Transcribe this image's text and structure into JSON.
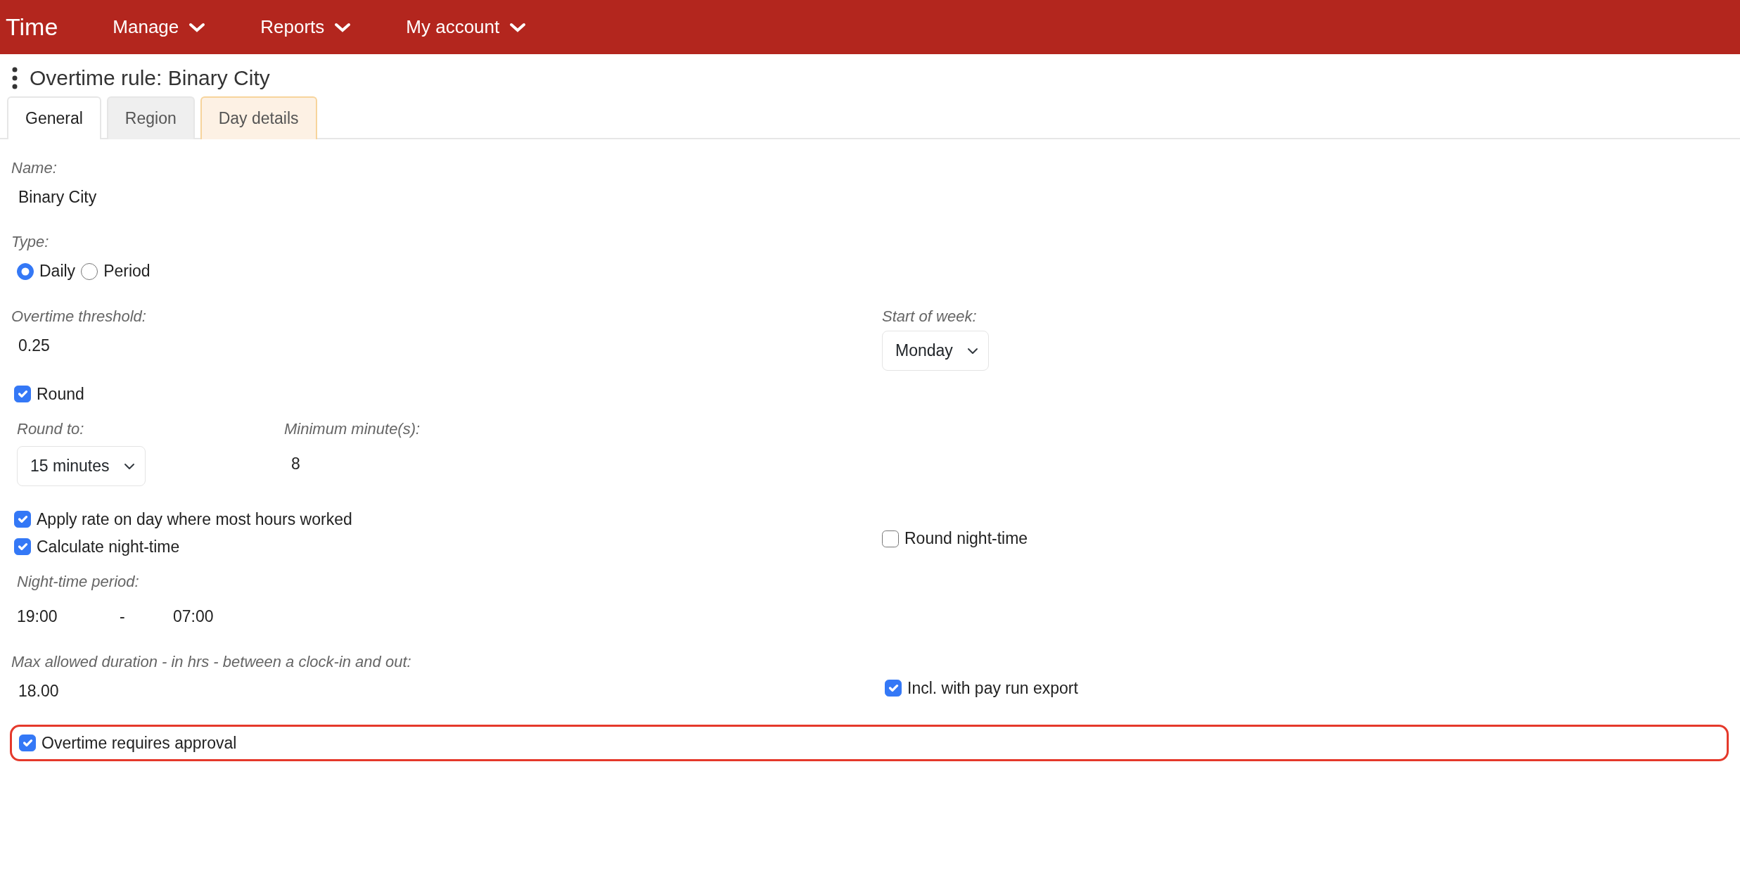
{
  "navbar": {
    "brand": "Time",
    "menus": [
      {
        "label": "Manage"
      },
      {
        "label": "Reports"
      },
      {
        "label": "My account"
      }
    ]
  },
  "page_title": "Overtime rule: Binary City",
  "tabs": [
    {
      "label": "General",
      "selected": true,
      "kind": "plain"
    },
    {
      "label": "Region",
      "selected": false,
      "kind": "plain"
    },
    {
      "label": "Day details",
      "selected": false,
      "kind": "warning"
    }
  ],
  "name": {
    "label": "Name:",
    "value": "Binary City"
  },
  "type": {
    "label": "Type:",
    "options": [
      {
        "label": "Daily",
        "selected": true
      },
      {
        "label": "Period",
        "selected": false
      }
    ]
  },
  "overtime_threshold": {
    "label": "Overtime threshold:",
    "value": "0.25"
  },
  "start_of_week": {
    "label": "Start of week:",
    "value": "Monday"
  },
  "round": {
    "label": "Round",
    "checked": true
  },
  "round_to": {
    "label": "Round to:",
    "value": "15 minutes"
  },
  "minimum_minutes": {
    "label": "Minimum minute(s):",
    "value": "8"
  },
  "apply_rate": {
    "label": "Apply rate on day where most hours worked",
    "checked": true
  },
  "calculate_night_time": {
    "label": "Calculate night-time",
    "checked": true
  },
  "round_night_time": {
    "label": "Round night-time",
    "checked": false
  },
  "night_time_period": {
    "label": "Night-time period:",
    "start": "19:00",
    "separator": "-",
    "end": "07:00"
  },
  "max_duration": {
    "label": "Max allowed duration - in hrs - between a clock-in and out:",
    "value": "18.00"
  },
  "incl_pay_run_export": {
    "label": "Incl. with pay run export",
    "checked": true
  },
  "overtime_requires_approval": {
    "label": "Overtime requires approval",
    "checked": true,
    "highlighted": true
  }
}
